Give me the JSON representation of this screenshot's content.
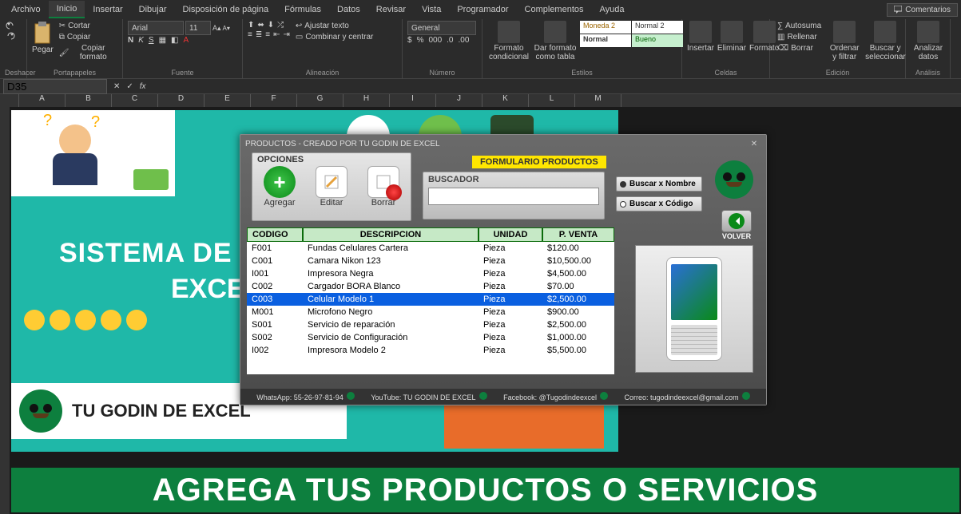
{
  "menu": {
    "tabs": [
      "Archivo",
      "Inicio",
      "Insertar",
      "Dibujar",
      "Disposición de página",
      "Fórmulas",
      "Datos",
      "Revisar",
      "Vista",
      "Programador",
      "Complementos",
      "Ayuda"
    ],
    "active": 1,
    "comments": "Comentarios"
  },
  "ribbon": {
    "undo_group": "Deshacer",
    "clipboard": {
      "paste": "Pegar",
      "cut": "Cortar",
      "copy": "Copiar",
      "copy_format": "Copiar formato",
      "label": "Portapapeles"
    },
    "font": {
      "name": "Arial",
      "size": "11",
      "label": "Fuente"
    },
    "alignment": {
      "wrap": "Ajustar texto",
      "merge": "Combinar y centrar",
      "label": "Alineación"
    },
    "number": {
      "format": "General",
      "label": "Número"
    },
    "styles": {
      "cond": "Formato condicional",
      "table": "Dar formato como tabla",
      "cells": {
        "moneda2": "Moneda 2",
        "normal2": "Normal 2",
        "normal": "Normal",
        "bueno": "Bueno"
      },
      "label": "Estilos"
    },
    "cells": {
      "insert": "Insertar",
      "delete": "Eliminar",
      "format": "Formato",
      "label": "Celdas"
    },
    "editing": {
      "autosum": "Autosuma",
      "fill": "Rellenar",
      "clear": "Borrar",
      "sort": "Ordenar y filtrar",
      "find": "Buscar y seleccionar",
      "label": "Edición"
    },
    "analysis": {
      "analyze": "Analizar datos",
      "label": "Análisis"
    }
  },
  "formula_bar": {
    "cell_ref": "D35",
    "fx": "fx",
    "formula": ""
  },
  "columns": [
    "A",
    "B",
    "C",
    "D",
    "E",
    "F",
    "G",
    "H",
    "I",
    "J",
    "K",
    "L",
    "M"
  ],
  "poster": {
    "line1": "SISTEMA DE",
    "line2": "EXCEL",
    "brand": "TU GODIN DE EXCEL"
  },
  "dialog": {
    "title": "PRODUCTOS - CREADO POR TU GODIN DE EXCEL",
    "opciones": {
      "legend": "OPCIONES",
      "agregar": "Agregar",
      "editar": "Editar",
      "borrar": "Borrar"
    },
    "form_title": "FORMULARIO PRODUCTOS",
    "buscador": {
      "label": "BUSCADOR",
      "placeholder": ""
    },
    "radios": {
      "xnombre": "Buscar x Nombre",
      "xcodigo": "Buscar x Código"
    },
    "volver": "VOLVER",
    "headers": {
      "codigo": "CODIGO",
      "descripcion": "DESCRIPCION",
      "unidad": "UNIDAD",
      "pventa": "P. VENTA"
    },
    "rows": [
      {
        "codigo": "F001",
        "desc": "Fundas Celulares Cartera",
        "unidad": "Pieza",
        "pv": "$120.00"
      },
      {
        "codigo": "C001",
        "desc": "Camara Nikon 123",
        "unidad": "Pieza",
        "pv": "$10,500.00"
      },
      {
        "codigo": "I001",
        "desc": "Impresora Negra",
        "unidad": "Pieza",
        "pv": "$4,500.00"
      },
      {
        "codigo": "C002",
        "desc": "Cargador BORA Blanco",
        "unidad": "Pieza",
        "pv": "$70.00"
      },
      {
        "codigo": "C003",
        "desc": "Celular Modelo 1",
        "unidad": "Pieza",
        "pv": "$2,500.00",
        "selected": true
      },
      {
        "codigo": "M001",
        "desc": "Microfono Negro",
        "unidad": "Pieza",
        "pv": "$900.00"
      },
      {
        "codigo": "S001",
        "desc": "Servicio de reparación",
        "unidad": "Pieza",
        "pv": "$2,500.00"
      },
      {
        "codigo": "S002",
        "desc": "Servicio de Configuración",
        "unidad": "Pieza",
        "pv": "$1,000.00"
      },
      {
        "codigo": "I002",
        "desc": "Impresora Modelo 2",
        "unidad": "Pieza",
        "pv": "$5,500.00"
      }
    ],
    "footer": {
      "whatsapp": "WhatsApp: 55-26-97-81-94",
      "youtube": "YouTube: TU GODIN DE EXCEL",
      "facebook": "Facebook: @Tugodindeexcel",
      "correo": "Correo: tugodindeexcel@gmail.com"
    }
  },
  "banner": "AGREGA TUS PRODUCTOS O SERVICIOS"
}
